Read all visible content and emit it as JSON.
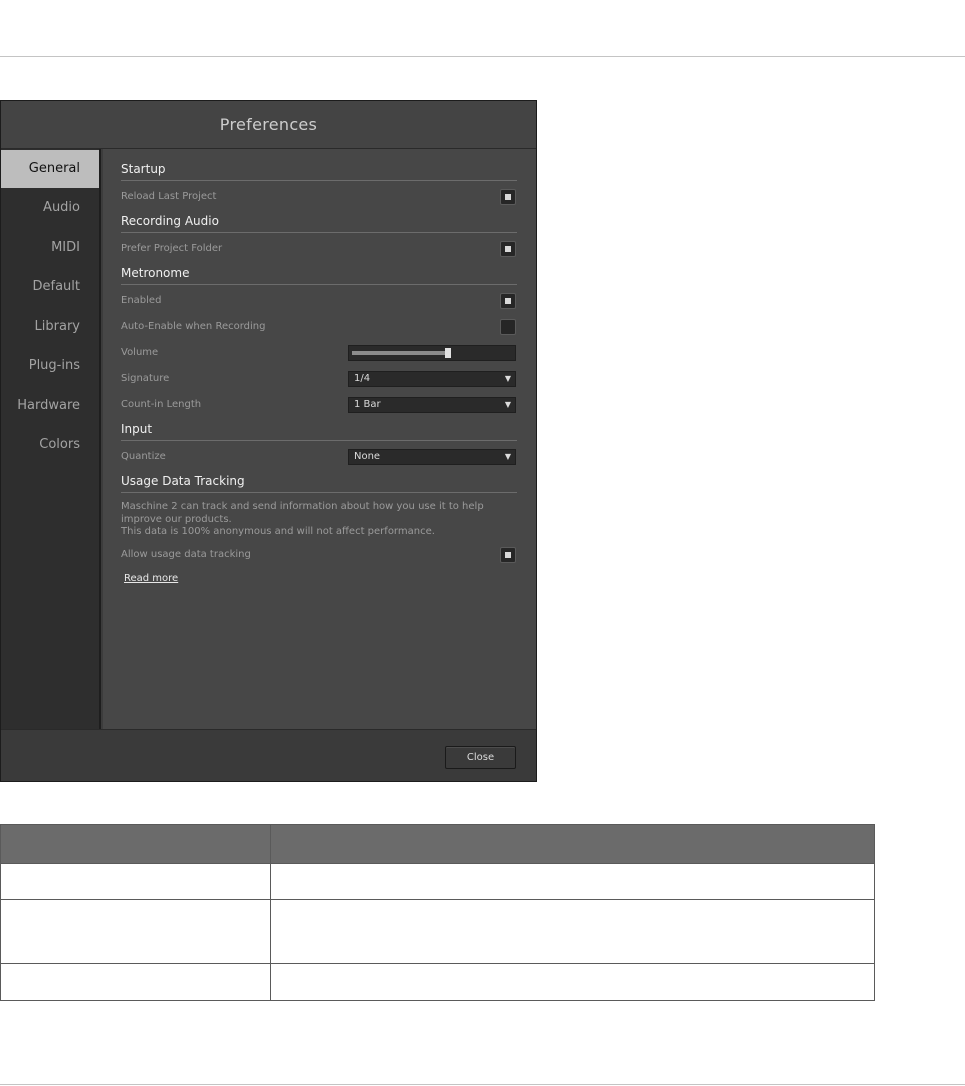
{
  "window": {
    "title": "Preferences",
    "nav": [
      {
        "label": "General",
        "active": true
      },
      {
        "label": "Audio",
        "active": false
      },
      {
        "label": "MIDI",
        "active": false
      },
      {
        "label": "Default",
        "active": false
      },
      {
        "label": "Library",
        "active": false
      },
      {
        "label": "Plug-ins",
        "active": false
      },
      {
        "label": "Hardware",
        "active": false
      },
      {
        "label": "Colors",
        "active": false
      }
    ],
    "sections": {
      "startup": {
        "title": "Startup",
        "reload_last_project": {
          "label": "Reload Last Project",
          "checked": true
        }
      },
      "recording_audio": {
        "title": "Recording Audio",
        "prefer_project_folder": {
          "label": "Prefer Project Folder",
          "checked": true
        }
      },
      "metronome": {
        "title": "Metronome",
        "enabled": {
          "label": "Enabled",
          "checked": true
        },
        "auto_enable": {
          "label": "Auto-Enable when Recording",
          "checked": false
        },
        "volume": {
          "label": "Volume",
          "level": 0.6
        },
        "signature": {
          "label": "Signature",
          "value": "1/4"
        },
        "count_in": {
          "label": "Count-in Length",
          "value": "1 Bar"
        }
      },
      "input": {
        "title": "Input",
        "quantize": {
          "label": "Quantize",
          "value": "None"
        }
      },
      "usage": {
        "title": "Usage Data Tracking",
        "description_line1": "Maschine 2 can track and send information about how you use it to help",
        "description_line2": "improve our products.",
        "description_line3": "This data is 100% anonymous and will not affect performance.",
        "allow": {
          "label": "Allow usage data tracking",
          "checked": true
        },
        "read_more": "Read more"
      }
    },
    "close_label": "Close"
  },
  "colors": {
    "window_bg": "#3c3c3c",
    "content_bg": "#474747",
    "sidebar_bg": "#2e2e2e",
    "active_nav_bg": "#bdbdbd",
    "table_header_bg": "#6b6b6b"
  }
}
